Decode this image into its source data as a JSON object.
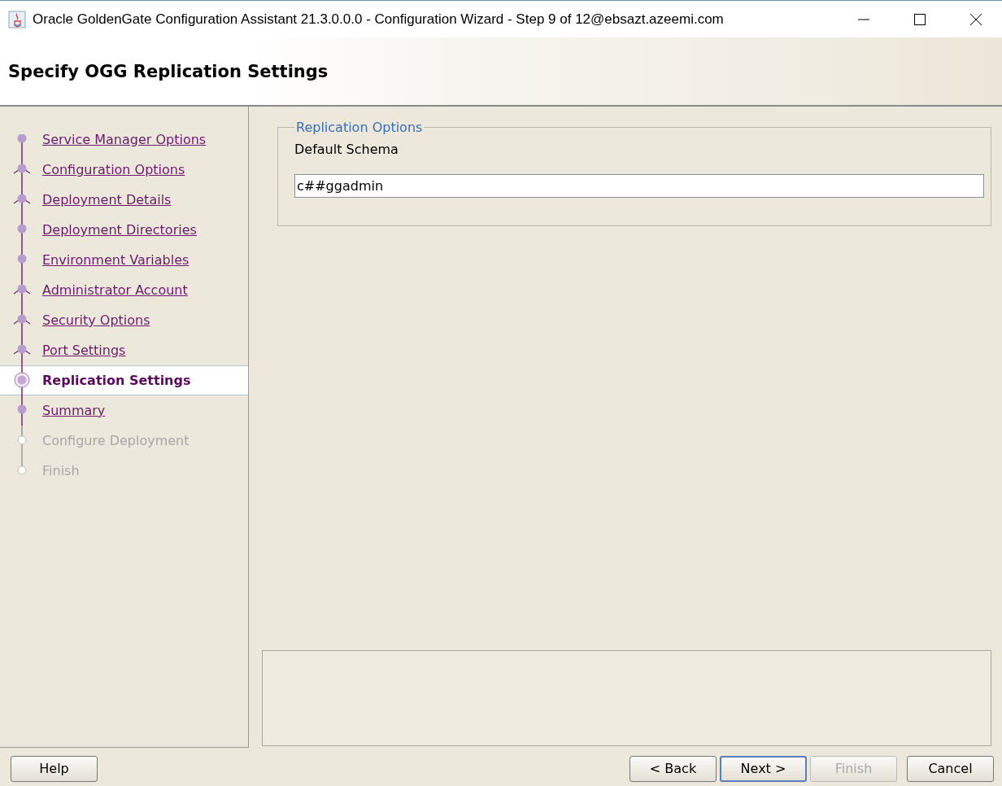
{
  "window": {
    "title": "Oracle GoldenGate Configuration Assistant 21.3.0.0.0 - Configuration Wizard - Step 9 of 12@ebsazt.azeemi.com"
  },
  "header": {
    "title": "Specify OGG Replication Settings"
  },
  "steps": [
    {
      "label": "Service Manager Options",
      "kind": "visited",
      "branch": false
    },
    {
      "label": "Configuration Options",
      "kind": "visited",
      "branch": true
    },
    {
      "label": "Deployment Details",
      "kind": "visited",
      "branch": true
    },
    {
      "label": "Deployment Directories",
      "kind": "visited",
      "branch": false
    },
    {
      "label": "Environment Variables",
      "kind": "visited",
      "branch": false
    },
    {
      "label": "Administrator Account",
      "kind": "visited",
      "branch": true
    },
    {
      "label": "Security Options",
      "kind": "visited",
      "branch": true
    },
    {
      "label": "Port Settings",
      "kind": "visited",
      "branch": true
    },
    {
      "label": "Replication Settings",
      "kind": "current",
      "branch": false
    },
    {
      "label": "Summary",
      "kind": "visited",
      "branch": false
    },
    {
      "label": "Configure Deployment",
      "kind": "pending",
      "branch": false
    },
    {
      "label": "Finish",
      "kind": "pending",
      "branch": false
    }
  ],
  "group": {
    "title": "Replication Options",
    "field_label": "Default Schema",
    "value": "c##ggadmin"
  },
  "left_buttons": [
    {
      "label": "Help",
      "disabled": false,
      "default": false
    }
  ],
  "right_buttons": [
    {
      "label": "< Back",
      "disabled": false,
      "default": false
    },
    {
      "label": "Next >",
      "disabled": false,
      "default": true
    },
    {
      "label": "Finish",
      "disabled": true,
      "default": false
    },
    {
      "label": "Cancel",
      "disabled": false,
      "default": false
    }
  ]
}
